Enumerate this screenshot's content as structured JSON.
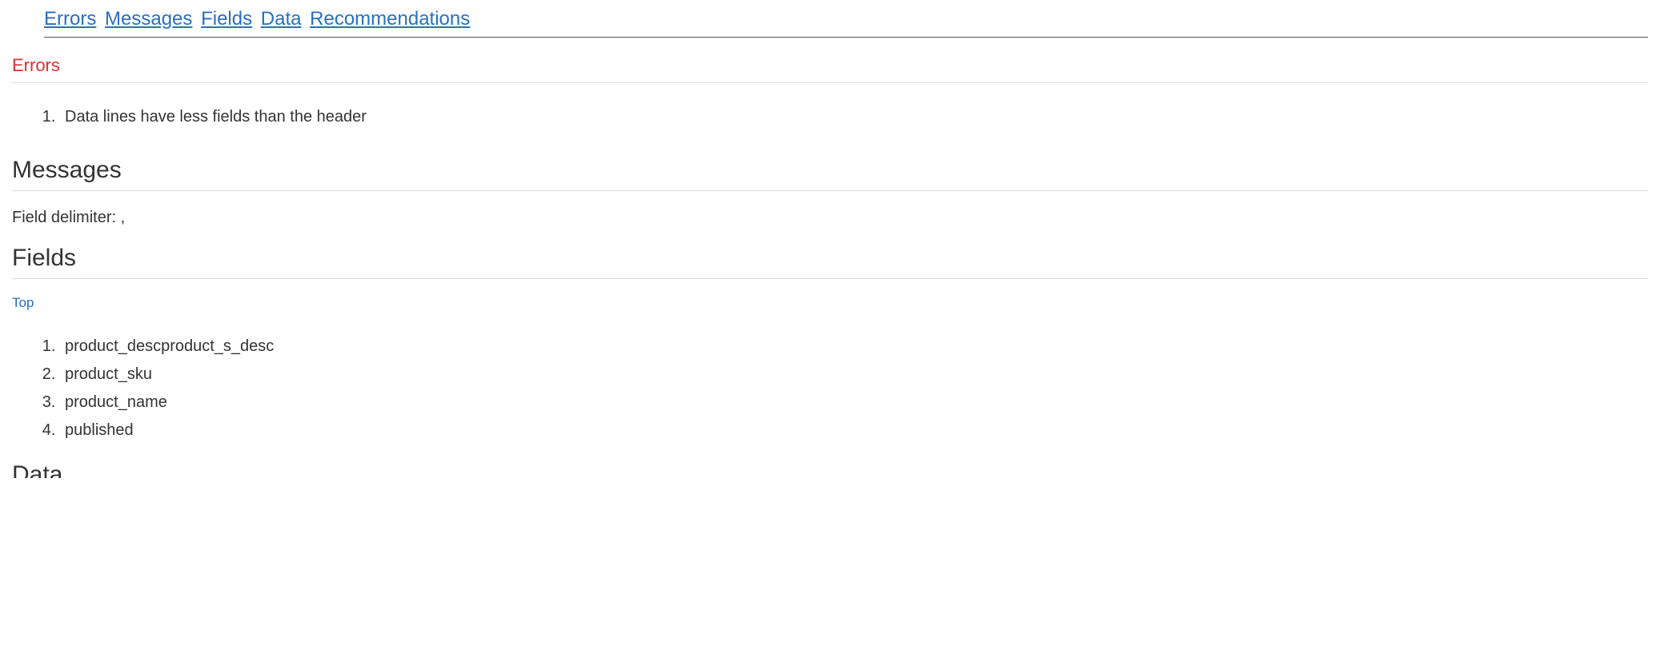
{
  "nav": {
    "items": [
      "Errors",
      "Messages",
      "Fields",
      "Data",
      "Recommendations"
    ]
  },
  "errors": {
    "heading": "Errors",
    "items": [
      "Data lines have less fields than the header"
    ]
  },
  "messages": {
    "heading": "Messages",
    "delimiter_line": "Field delimiter: ,"
  },
  "fields": {
    "heading": "Fields",
    "top_link": "Top",
    "items": [
      "product_descproduct_s_desc",
      "product_sku",
      "product_name",
      "published"
    ]
  },
  "data": {
    "heading": "Data"
  }
}
